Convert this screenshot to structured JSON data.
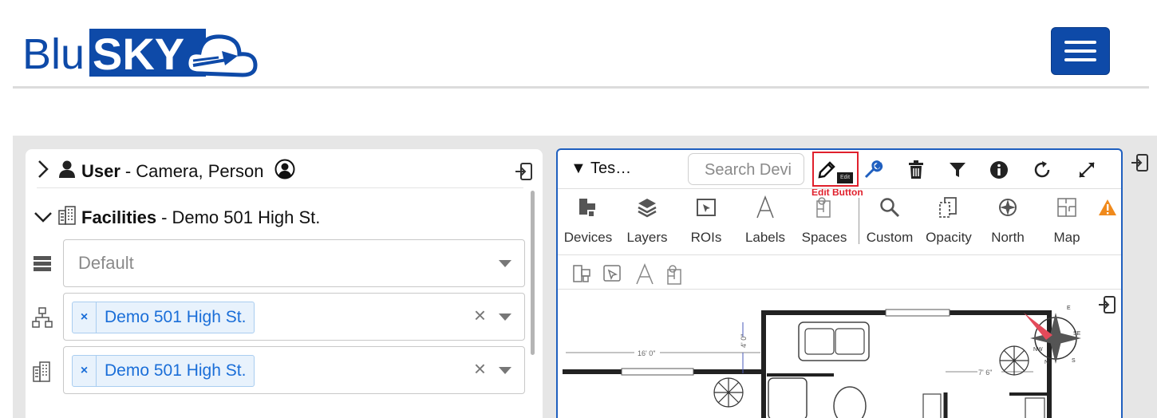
{
  "header": {
    "logo_text_left": "Blu",
    "logo_text_right": "SKY"
  },
  "user_section": {
    "label": "User",
    "separator": "-",
    "value": "Camera, Person"
  },
  "facilities_section": {
    "label": "Facilities",
    "separator": "-",
    "value": "Demo 501 High St."
  },
  "fields": [
    {
      "placeholder": "Default"
    },
    {
      "chip": "Demo 501 High St.",
      "chip_x": "×",
      "clear": "×"
    },
    {
      "chip": "Demo 501 High St.",
      "chip_x": "×",
      "clear": "×"
    }
  ],
  "floorplan_panel": {
    "title": "▼ Tes…",
    "search_placeholder": "Search Devi",
    "edit_tooltip": "Edit",
    "edit_annotation": "Edit Button",
    "tools": [
      "Devices",
      "Layers",
      "ROIs",
      "Labels",
      "Spaces",
      "Custom",
      "Opacity",
      "North",
      "Map"
    ],
    "map_dimensions": [
      "16' 0\"",
      "7' 6\"",
      "4' 0\""
    ],
    "compass_labels": [
      "E",
      "SE",
      "S",
      "NW",
      "N"
    ]
  },
  "colors": {
    "brand_blue": "#0e4aa8",
    "panel_border": "#1f5fbf",
    "chip_text": "#1a6ed8",
    "annotation_red": "#e0202c",
    "warning": "#f08a1c"
  }
}
